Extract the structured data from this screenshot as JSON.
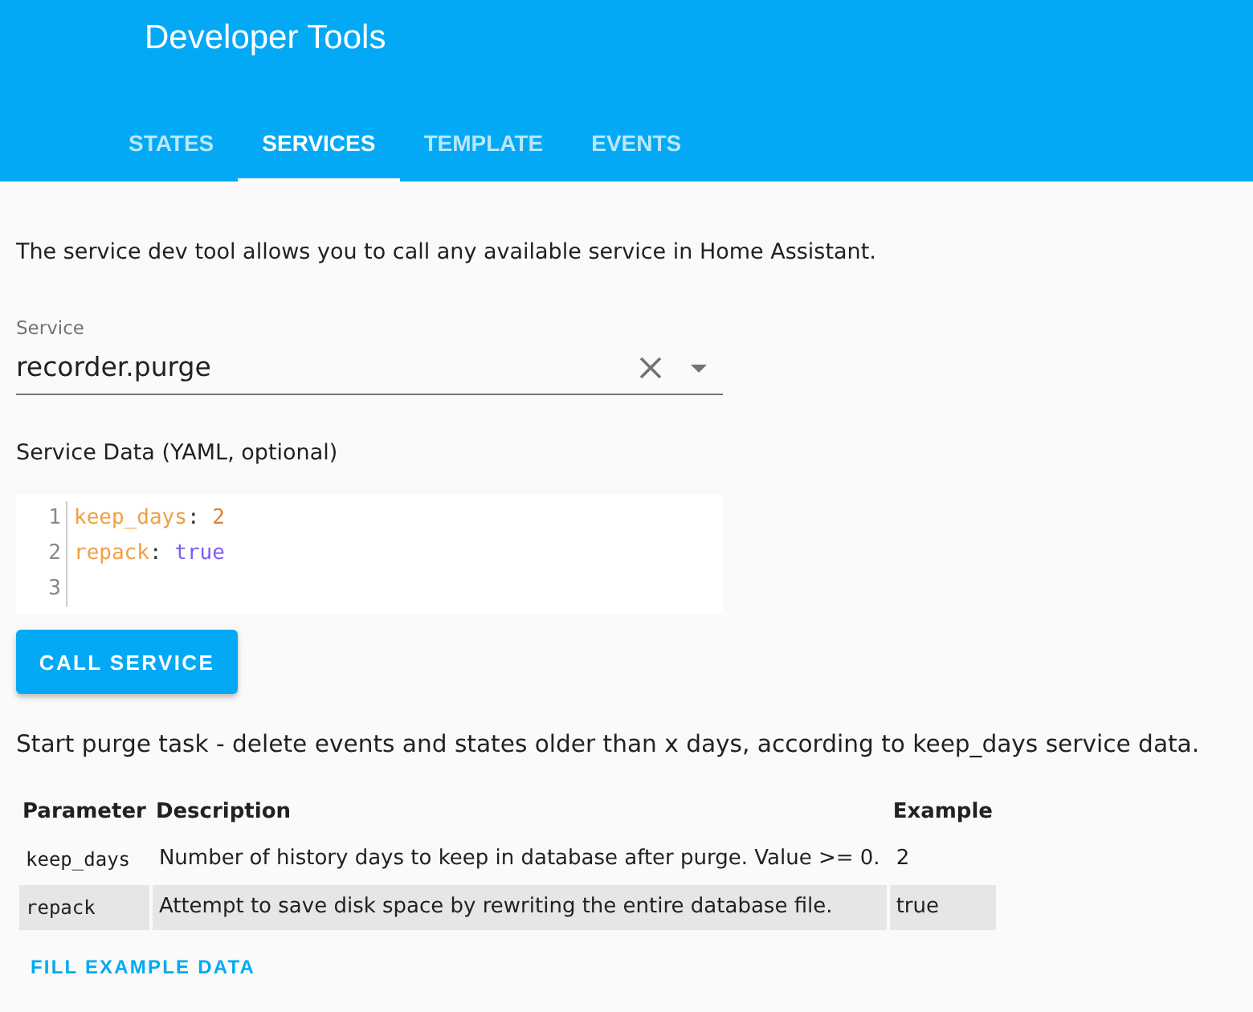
{
  "header": {
    "title": "Developer Tools"
  },
  "tabs": [
    {
      "label": "STATES",
      "selected": false
    },
    {
      "label": "SERVICES",
      "selected": true
    },
    {
      "label": "TEMPLATE",
      "selected": false
    },
    {
      "label": "EVENTS",
      "selected": false
    }
  ],
  "intro": "The service dev tool allows you to call any available service in Home Assistant.",
  "service_field": {
    "label": "Service",
    "value": "recorder.purge"
  },
  "service_data": {
    "label": "Service Data (YAML, optional)",
    "lines": [
      {
        "number": "1",
        "tokens": [
          {
            "kind": "key",
            "text": "keep_days"
          },
          {
            "kind": "punct",
            "text": ": "
          },
          {
            "kind": "number",
            "text": "2"
          }
        ]
      },
      {
        "number": "2",
        "tokens": [
          {
            "kind": "key",
            "text": "repack"
          },
          {
            "kind": "punct",
            "text": ": "
          },
          {
            "kind": "atom",
            "text": "true"
          }
        ]
      },
      {
        "number": "3"
      }
    ]
  },
  "call_button": "CALL SERVICE",
  "description": "Start purge task - delete events and states older than x days, according to keep_days service data.",
  "parameters": {
    "columns": [
      "Parameter",
      "Description",
      "Example"
    ],
    "rows": [
      {
        "parameter": "keep_days",
        "description": "Number of history days to keep in database after purge. Value >= 0.",
        "example": "2"
      },
      {
        "parameter": "repack",
        "description": "Attempt to save disk space by rewriting the entire database file.",
        "example": "true"
      }
    ]
  },
  "fill_button": "FILL EXAMPLE DATA"
}
